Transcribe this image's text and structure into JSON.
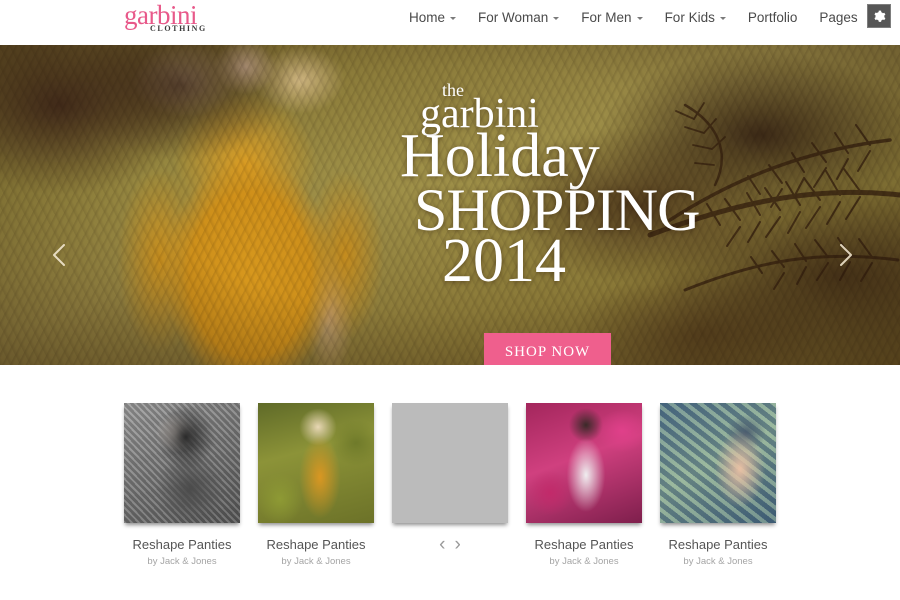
{
  "header": {
    "logo": {
      "main": "garbini",
      "sub": "CLOTHING"
    },
    "nav": [
      {
        "label": "Home",
        "caret": true
      },
      {
        "label": "For Woman",
        "caret": true
      },
      {
        "label": "For Men",
        "caret": true
      },
      {
        "label": "For Kids",
        "caret": true
      },
      {
        "label": "Portfolio",
        "caret": false
      },
      {
        "label": "Pages",
        "caret": false
      }
    ],
    "settings_icon": "gear-icon"
  },
  "hero": {
    "eyebrow": "the",
    "brand": "garbini",
    "line1": "Holiday",
    "line2": "SHOPPING",
    "line3": "2014",
    "cta_label": "SHOP NOW",
    "prev_icon": "chevron-left-icon",
    "next_icon": "chevron-right-icon",
    "accent_color": "#ef5f8d"
  },
  "products": {
    "prev_icon": "chevron-left-icon",
    "next_icon": "chevron-right-icon",
    "items": [
      {
        "title": "Reshape Panties",
        "author": "by Jack & Jones"
      },
      {
        "title": "Reshape Panties",
        "author": "by Jack & Jones"
      },
      {
        "title": "",
        "author": ""
      },
      {
        "title": "Reshape Panties",
        "author": "by Jack & Jones"
      },
      {
        "title": "Reshape Panties",
        "author": "by Jack & Jones"
      }
    ]
  }
}
